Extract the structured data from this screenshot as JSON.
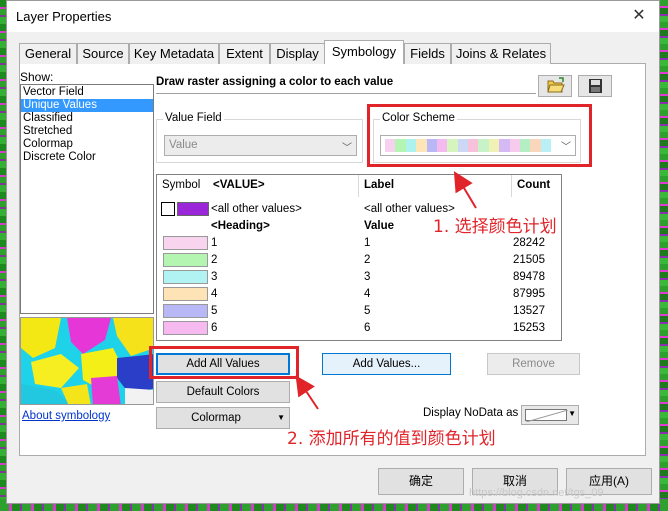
{
  "window": {
    "title": "Layer Properties"
  },
  "tabs": [
    {
      "label": "General"
    },
    {
      "label": "Source"
    },
    {
      "label": "Key Metadata"
    },
    {
      "label": "Extent"
    },
    {
      "label": "Display"
    },
    {
      "label": "Symbology",
      "active": true
    },
    {
      "label": "Fields"
    },
    {
      "label": "Joins & Relates"
    }
  ],
  "show": {
    "label": "Show:",
    "items": [
      {
        "label": "Vector Field"
      },
      {
        "label": "Unique Values",
        "selected": true
      },
      {
        "label": "Classified"
      },
      {
        "label": "Stretched"
      },
      {
        "label": "Colormap"
      },
      {
        "label": "Discrete Color"
      }
    ],
    "about_link": "About symbology"
  },
  "description": "Draw raster assigning a color to each value",
  "value_field": {
    "legend": "Value Field",
    "value": "Value"
  },
  "color_scheme": {
    "legend": "Color Scheme",
    "swatches": [
      "#f7d2f0",
      "#b5f5b3",
      "#aef2ef",
      "#fde5b8",
      "#b9b7f5",
      "#f4b9ef",
      "#d6f5be",
      "#ccd7f5",
      "#f7c1d9",
      "#c8f2c8",
      "#f1f1b6",
      "#d5b9f4",
      "#f7cbee",
      "#b6eec4",
      "#f9d6bc",
      "#b8f0f6"
    ]
  },
  "table": {
    "headers": {
      "symbol": "Symbol",
      "value": "<VALUE>",
      "label": "Label",
      "count": "Count"
    },
    "other": {
      "value": "<all other values>",
      "label": "<all other values>",
      "color": "#9b26d9"
    },
    "heading": {
      "value": "<Heading>",
      "label": "Value"
    },
    "rows": [
      {
        "value": "1",
        "label": "1",
        "count": "28242",
        "color": "#f9d4ef"
      },
      {
        "value": "2",
        "label": "2",
        "count": "21505",
        "color": "#b3f5b1"
      },
      {
        "value": "3",
        "label": "3",
        "count": "89478",
        "color": "#b1f2f2"
      },
      {
        "value": "4",
        "label": "4",
        "count": "87995",
        "color": "#fde3b5"
      },
      {
        "value": "5",
        "label": "5",
        "count": "13527",
        "color": "#b9b8f6"
      },
      {
        "value": "6",
        "label": "6",
        "count": "15253",
        "color": "#f6b9f0"
      }
    ]
  },
  "buttons": {
    "add_all": "Add All Values",
    "add_values": "Add Values...",
    "remove": "Remove",
    "default_colors": "Default Colors",
    "colormap": "Colormap",
    "ok": "确定",
    "cancel": "取消",
    "apply": "应用(A)"
  },
  "nodata_label": "Display NoData as",
  "annotations": {
    "step1": "1. 选择颜色计划",
    "step2": "2. 添加所有的值到颜色计划"
  },
  "watermark": "https://blog.csdn.net/tgs_09",
  "colors": {
    "accent": "#e0242a",
    "selection": "#3399ff"
  }
}
